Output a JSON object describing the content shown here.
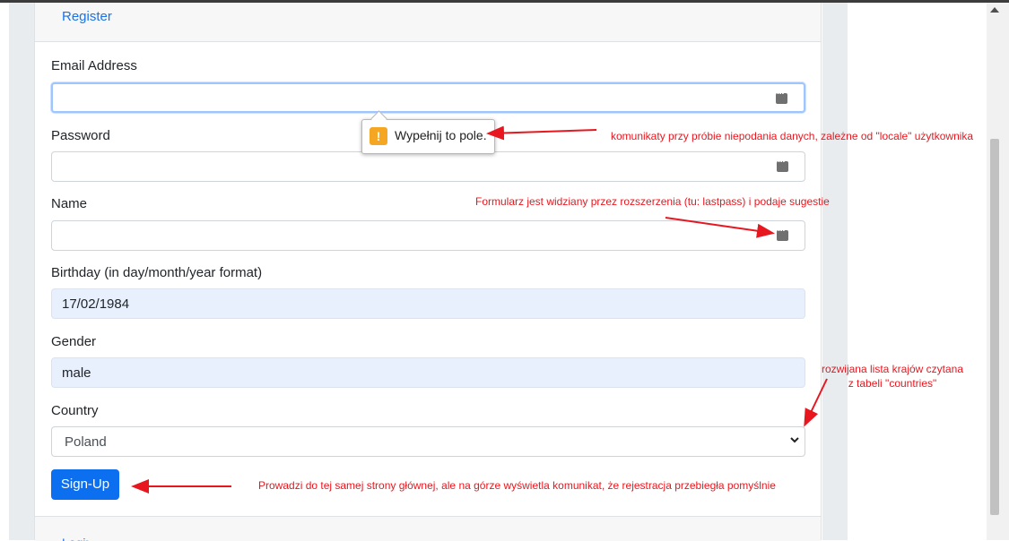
{
  "header": {
    "register_link": "Register"
  },
  "form": {
    "email_label": "Email Address",
    "email_value": "",
    "password_label": "Password",
    "password_value": "",
    "name_label": "Name",
    "name_value": "",
    "birthday_label": "Birthday (in day/month/year format)",
    "birthday_value": "17/02/1984",
    "gender_label": "Gender",
    "gender_value": "male",
    "country_label": "Country",
    "country_value": "Poland",
    "submit_label": "Sign-Up"
  },
  "footer": {
    "link": "Login"
  },
  "tooltip": {
    "text": "Wypełnij to pole."
  },
  "annotations": {
    "locale_note": "komunikaty przy próbie niepodania danych, zależne od \"locale\" użytkownika",
    "extension_note": "Formularz jest widziany przez rozszerzenia (tu: lastpass) i podaje sugestie",
    "countries_note_line1": "rozwijana lista krajów czytana",
    "countries_note_line2": "z tabeli \"countries\"",
    "signup_note": "Prowadzi do tej samej strony głównej, ale na górze wyświetla komunikat, że rejestracja przebiegła pomyślnie"
  },
  "colors": {
    "accent": "#0b6ff0",
    "annotation": "#e8171f",
    "tooltip_warning": "#f5a623"
  },
  "icons": {
    "lastpass": "lastpass-icon",
    "warning": "warning-icon",
    "select": "chevron-down-icon"
  }
}
